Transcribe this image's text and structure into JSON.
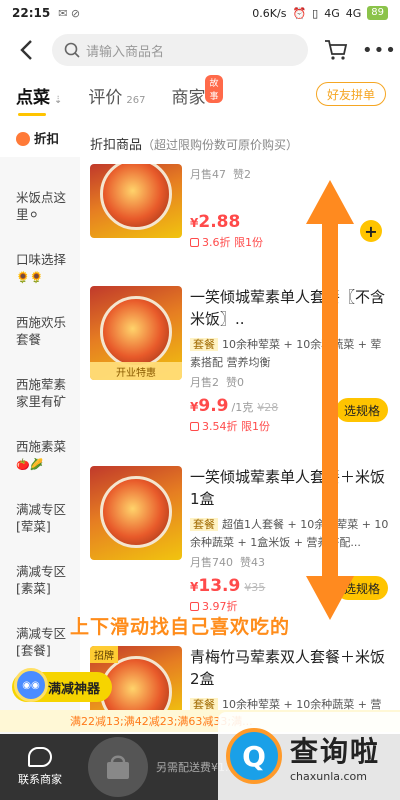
{
  "status_bar": {
    "time": "22:15",
    "speed": "0.6K/s",
    "network1": "4G",
    "network2": "4G",
    "battery": "89"
  },
  "header": {
    "search_placeholder": "请输入商品名"
  },
  "tabs": [
    {
      "label": "点菜",
      "active": true
    },
    {
      "label": "评价",
      "count": "267"
    },
    {
      "label": "商家",
      "badge": "故事"
    }
  ],
  "group_button": "好友拼单",
  "sidebar": {
    "items": [
      {
        "label": "折扣",
        "active": true
      },
      {
        "label": "米饭点这里⚪"
      },
      {
        "label": "口味选择",
        "emoji": "🌻🌻"
      },
      {
        "label": "西施欢乐套餐"
      },
      {
        "label": "西施荤素家里有矿"
      },
      {
        "label": "西施素菜",
        "emoji": "🍅🌽"
      },
      {
        "label": "满减专区[荤菜]"
      },
      {
        "label": "满减专区[素菜]"
      },
      {
        "label": "满减专区[套餐]"
      }
    ]
  },
  "section": {
    "title": "折扣商品",
    "note": "（超过限购份数可原价购买）"
  },
  "dishes": [
    {
      "name": "",
      "sales": "月售47",
      "likes": "赞2",
      "price": "2.88",
      "discount": "3.6折 限1份",
      "action": "+"
    },
    {
      "name": "一笑倾城荤素单人套餐〖不含米饭〗..",
      "image_tag": "开业特惠",
      "chip_tag": "套餐",
      "chips": "10余种荤菜 + 10余种蔬菜 + 荤素搭配 营养均衡",
      "sales": "月售2",
      "likes": "赞0",
      "price": "9.9",
      "unit": "/1克",
      "original": "¥28",
      "discount": "3.54折 限1份",
      "action": "选规格"
    },
    {
      "name": "一笑倾城荤素单人套餐＋米饭1盒",
      "chip_tag": "套餐",
      "chips": "超值1人套餐 + 10余种荤菜 + 10余种蔬菜 + 1盒米饭 + 营养搭配...",
      "sales": "月售740",
      "likes": "赞43",
      "price": "13.9",
      "original": "¥35",
      "discount": "3.97折",
      "action": "选规格"
    },
    {
      "name": "青梅竹马荤素双人套餐＋米饭2盒",
      "image_brand": "招牌",
      "chip_tag": "套餐",
      "chips": "10余种荤菜 + 10余种蔬菜 + 营养"
    }
  ],
  "overlay_caption": "上下滑动找自己喜欢吃的",
  "reduce_tool": "满减神器",
  "promo": "满22减13;满42减23;满63减33;满...",
  "bottom": {
    "contact": "联系商家",
    "shipping": "另需配送费¥1.5"
  },
  "watermark": {
    "cn": "查询啦",
    "en": "chaxunla.com"
  }
}
